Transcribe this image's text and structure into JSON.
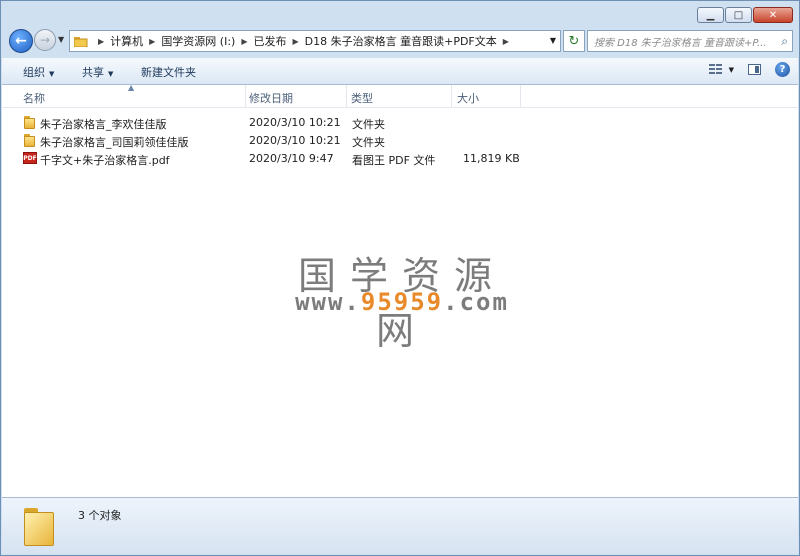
{
  "window": {
    "controls": {
      "minimize": "▁",
      "maximize": "□",
      "close": "✕"
    }
  },
  "nav": {
    "back_glyph": "←",
    "forward_glyph": "→",
    "breadcrumb": [
      "计算机",
      "国学资源网 (I:)",
      "已发布",
      "D18 朱子治家格言 童音跟读+PDF文本"
    ],
    "refresh_glyph": "↻",
    "search_placeholder": "搜索 D18 朱子治家格言 童音跟读+P..."
  },
  "toolbar": {
    "organize_label": "组织",
    "share_label": "共享",
    "new_folder_label": "新建文件夹",
    "help_glyph": "?"
  },
  "columns": {
    "name": "名称",
    "modified": "修改日期",
    "type": "类型",
    "size": "大小"
  },
  "files": [
    {
      "name": "朱子治家格言_李欢佳佳版",
      "modified": "2020/3/10 10:21",
      "type": "文件夹",
      "size": "",
      "icon": "folder-icon"
    },
    {
      "name": "朱子治家格言_司国莉领佳佳版",
      "modified": "2020/3/10 10:21",
      "type": "文件夹",
      "size": "",
      "icon": "folder-icon"
    },
    {
      "name": "千字文+朱子治家格言.pdf",
      "modified": "2020/3/10 9:47",
      "type": "看图王 PDF 文件",
      "size": "11,819 KB",
      "icon": "pdf-icon"
    }
  ],
  "watermark": {
    "title": "国学资源网",
    "url_prefix": "www.",
    "url_highlight": "95959",
    "url_suffix": ".com",
    "highlight_color": "#e88a2a"
  },
  "status": {
    "count_text": "3 个对象"
  }
}
